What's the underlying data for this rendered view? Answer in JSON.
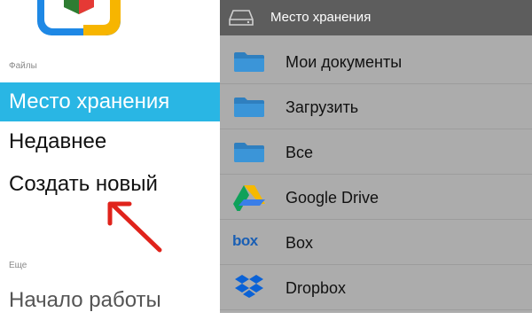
{
  "left": {
    "files_label": "Файлы",
    "nav": [
      {
        "label": "Место хранения",
        "active": true
      },
      {
        "label": "Недавнее",
        "active": false
      },
      {
        "label": "Создать новый",
        "active": false
      }
    ],
    "more_label": "Еще",
    "more_nav": [
      {
        "label": "Начало работы"
      }
    ]
  },
  "right": {
    "title": "Место хранения",
    "title_icon": "hard-drive-icon",
    "items": [
      {
        "label": "Мои документы",
        "icon": "folder-icon"
      },
      {
        "label": "Загрузить",
        "icon": "folder-icon"
      },
      {
        "label": "Все",
        "icon": "folder-icon"
      },
      {
        "label": "Google Drive",
        "icon": "google-drive-icon"
      },
      {
        "label": "Box",
        "icon": "box-icon",
        "icon_text": "box"
      },
      {
        "label": "Dropbox",
        "icon": "dropbox-icon"
      }
    ]
  },
  "colors": {
    "accent": "#29b6e4",
    "topbar": "#5d5d5d",
    "panel": "#acacac",
    "folder": "#3b8fd0",
    "arrow": "#e0231b"
  }
}
